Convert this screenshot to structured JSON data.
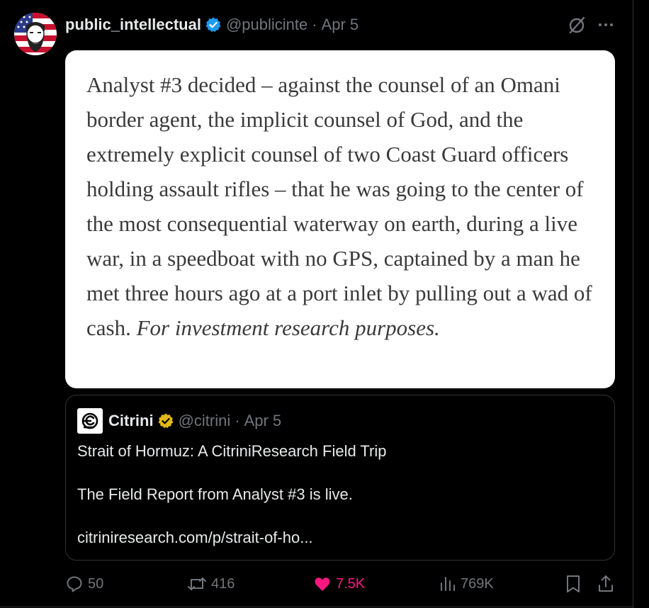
{
  "tweet": {
    "display_name": "public_intellectual",
    "handle": "@publicinte",
    "separator": "·",
    "date": "Apr 5",
    "image_text": {
      "body": "Analyst #3 decided – against the counsel of an Omani border agent, the implicit counsel of God, and the extremely explicit counsel of two Coast Guard officers holding assault rifles – that he was going to the center of the most consequential waterway on earth, during a live war, in a speedboat with no GPS, captained by a man he met three hours ago at a port inlet by pulling out a wad of cash.",
      "italic_tail": "For investment research purposes."
    }
  },
  "quote": {
    "display_name": "Citrini",
    "handle": "@citrini",
    "separator": "·",
    "date": "Apr 5",
    "title": "Strait of Hormuz: A CitriniResearch Field Trip",
    "line2": "The Field Report from Analyst #3 is live.",
    "link": "citriniresearch.com/p/strait-of-ho..."
  },
  "actions": {
    "replies": "50",
    "reposts": "416",
    "likes": "7.5K",
    "views": "769K"
  },
  "colors": {
    "background": "#000000",
    "text_primary": "#e7e9ea",
    "text_secondary": "#71767b",
    "verified_blue": "#1d9bf0",
    "verified_gold": "#e2b719",
    "like_pink": "#f91880",
    "border": "#2f3336"
  },
  "icons": [
    "verified-badge-icon",
    "grok-icon",
    "more-icon",
    "reply-icon",
    "repost-icon",
    "heart-icon",
    "views-icon",
    "bookmark-icon",
    "share-icon"
  ]
}
